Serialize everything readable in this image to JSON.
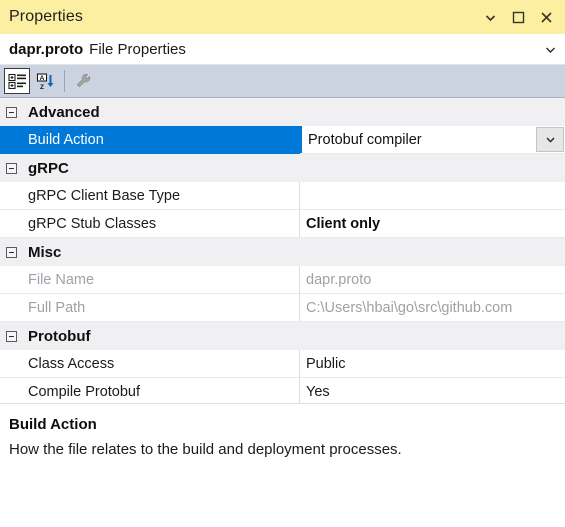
{
  "window": {
    "title": "Properties",
    "controls": [
      {
        "name": "window-dropdown",
        "icon": "chevron-down-icon"
      },
      {
        "name": "window-dock",
        "icon": "dock-window-icon"
      },
      {
        "name": "window-close",
        "icon": "close-icon"
      }
    ]
  },
  "object_header": {
    "object_name": "dapr.proto",
    "object_kind": "File Properties",
    "dropdown_icon": "chevron-down-icon"
  },
  "toolbar": {
    "buttons": [
      {
        "name": "categorized-view-button",
        "icon": "categorized-icon",
        "pressed": true
      },
      {
        "name": "alphabetical-sort-button",
        "icon": "sort-az-icon",
        "pressed": false
      },
      {
        "name": "property-pages-button",
        "icon": "wrench-icon",
        "pressed": false,
        "disabled": true
      }
    ]
  },
  "grid": {
    "categories": [
      {
        "label": "Advanced",
        "expanded": true,
        "rows": [
          {
            "name": "Build Action",
            "value": "Protobuf compiler",
            "selected": true,
            "editing": true,
            "has_dropdown": true,
            "bold": false,
            "readonly": false
          }
        ]
      },
      {
        "label": "gRPC",
        "expanded": true,
        "rows": [
          {
            "name": "gRPC Client Base Type",
            "value": "",
            "selected": false,
            "editing": false,
            "has_dropdown": false,
            "bold": false,
            "readonly": false
          },
          {
            "name": "gRPC Stub Classes",
            "value": "Client only",
            "selected": false,
            "editing": false,
            "has_dropdown": false,
            "bold": true,
            "readonly": false
          }
        ]
      },
      {
        "label": "Misc",
        "expanded": true,
        "rows": [
          {
            "name": "File Name",
            "value": "dapr.proto",
            "selected": false,
            "editing": false,
            "has_dropdown": false,
            "bold": false,
            "readonly": true
          },
          {
            "name": "Full Path",
            "value": "C:\\Users\\hbai\\go\\src\\github.com",
            "selected": false,
            "editing": false,
            "has_dropdown": false,
            "bold": false,
            "readonly": true
          }
        ]
      },
      {
        "label": "Protobuf",
        "expanded": true,
        "rows": [
          {
            "name": "Class Access",
            "value": "Public",
            "selected": false,
            "editing": false,
            "has_dropdown": false,
            "bold": false,
            "readonly": false
          },
          {
            "name": "Compile Protobuf",
            "value": "Yes",
            "selected": false,
            "editing": false,
            "has_dropdown": false,
            "bold": false,
            "readonly": false
          }
        ]
      }
    ]
  },
  "description": {
    "title": "Build Action",
    "text": "How the file relates to the build and deployment processes."
  },
  "colors": {
    "titlebar": "#fcefa1",
    "selection": "#0078d7",
    "toolbar": "#ccd3e0",
    "category": "#f0f0f3"
  }
}
